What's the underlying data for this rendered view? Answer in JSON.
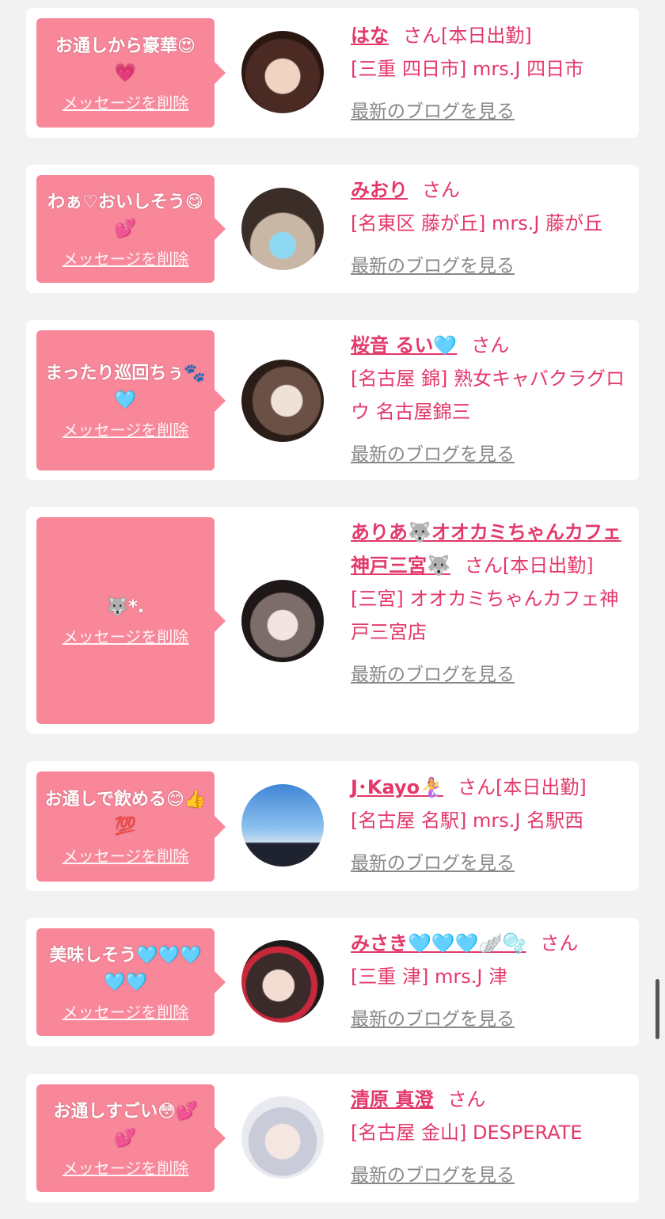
{
  "delete_label": "メッセージを削除",
  "blog_label": "最新のブログを見る",
  "san_suffix": "さん",
  "colors": {
    "bubble": "#f8879a",
    "text": "#e4386a",
    "link_gray": "#888888"
  },
  "items": [
    {
      "message": "お通しから豪華😍💗",
      "name": "はな",
      "suffix": "[本日出勤]",
      "location": "[三重 四日市] mrs.J 四日市"
    },
    {
      "message": "わぁ♡おいしそう😋💕",
      "name": "みおり",
      "suffix": "",
      "location": "[名東区 藤が丘] mrs.J 藤が丘"
    },
    {
      "message": "まったり巡回ちぅ🐾🩵",
      "name": "桜音 るい🩵",
      "suffix": "",
      "location": "[名古屋 錦] 熟女キャバクラグロウ 名古屋錦三"
    },
    {
      "message": "🐺*.",
      "name": "ありあ🐺オオカミちゃんカフェ神戸三宮🐺",
      "suffix": "[本日出勤]",
      "location": "[三宮] オオカミちゃんカフェ神戸三宮店"
    },
    {
      "message": "お通しで飲める😊👍💯",
      "name": "J･Kayo🧜‍♀️",
      "suffix": "[本日出勤]",
      "location": "[名古屋 名駅] mrs.J 名駅西"
    },
    {
      "message": "美味しそう🩵🩵🩵🩵🩵",
      "name": "みさき🩵🩵🩵🪽🫧",
      "suffix": "",
      "location": "[三重 津] mrs.J 津"
    },
    {
      "message": "お通しすごい😳💕💕",
      "name": "清原 真澄",
      "suffix": "",
      "location": "[名古屋 金山] DESPERATE"
    }
  ]
}
